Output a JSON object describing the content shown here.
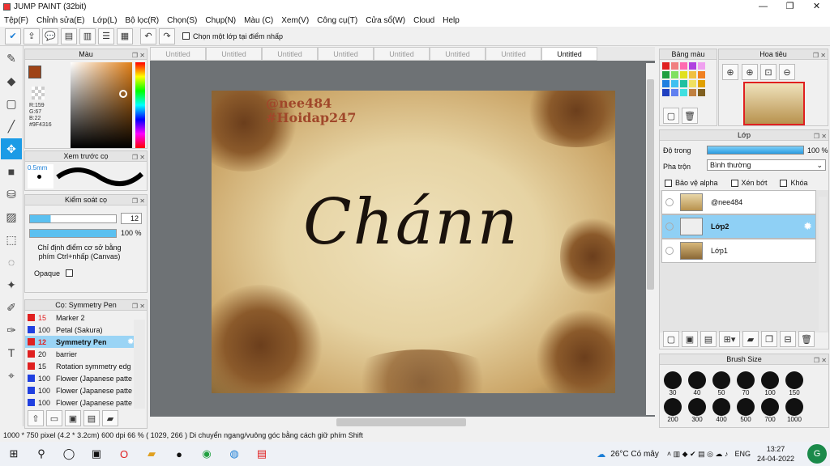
{
  "window": {
    "title": "JUMP PAINT (32bit)",
    "min": "—",
    "max": "❐",
    "close": "✕"
  },
  "menu": [
    "Tệp(F)",
    "Chỉnh sửa(E)",
    "Lớp(L)",
    "Bộ lọc(R)",
    "Chọn(S)",
    "Chụp(N)",
    "Màu (C)",
    "Xem(V)",
    "Công cụ(T)",
    "Cửa sổ(W)",
    "Cloud",
    "Help"
  ],
  "toolbar": {
    "select_layer_label": "Chọn một lớp tại điểm nhấp"
  },
  "color_panel": {
    "title": "Màu",
    "r": "R:159",
    "g": "G:67",
    "b": "B:22",
    "hex": "#9F4316",
    "fg_color": "#9F4316"
  },
  "preview_panel": {
    "title": "Xem trước cọ",
    "size": "0.5mm"
  },
  "brush_control": {
    "title": "Kiểm soát cọ",
    "size_value": "12",
    "opacity_value": "100 %",
    "hint": "Chỉ định điểm cơ sở bằng phím Ctrl+nhấp (Canvas)",
    "opaque_label": "Opaque"
  },
  "brush_list": {
    "title": "Cọ: Symmetry Pen",
    "items": [
      {
        "num": "15",
        "name": "Marker 2",
        "color": "#e02020"
      },
      {
        "num": "100",
        "name": "Petal (Sakura)",
        "color": "#2040e0"
      },
      {
        "num": "12",
        "name": "Symmetry Pen",
        "color": "#e02020"
      },
      {
        "num": "20",
        "name": "barrier",
        "color": "#e02020"
      },
      {
        "num": "15",
        "name": "Rotation symmetry edg",
        "color": "#e02020"
      },
      {
        "num": "100",
        "name": "Flower (Japanese patte",
        "color": "#2040e0"
      },
      {
        "num": "100",
        "name": "Flower (Japanese patte",
        "color": "#2040e0"
      },
      {
        "num": "100",
        "name": "Flower (Japanese patte",
        "color": "#2040e0"
      }
    ]
  },
  "tabs": [
    "Untitled",
    "Untitled",
    "Untitled",
    "Untitled",
    "Untitled",
    "Untitled",
    "Untitled",
    "Untitled"
  ],
  "artwork": {
    "watermark1": "@nee484",
    "watermark2": "#Hoidap247",
    "main_text": "Chánn"
  },
  "palette_panel": {
    "title": "Bảng màu"
  },
  "navigator_panel": {
    "title": "Hoa tiêu"
  },
  "layer_panel": {
    "title": "Lớp",
    "opacity_label": "Độ trong",
    "opacity_value": "100 %",
    "blend_label": "Pha trộn",
    "blend_value": "Bình thường",
    "protect_alpha": "Bảo vệ alpha",
    "clip": "Xén bớt",
    "lock": "Khóa",
    "layers": [
      {
        "name": "@nee484"
      },
      {
        "name": "Lớp2"
      },
      {
        "name": "Lớp1"
      }
    ]
  },
  "brush_size_panel": {
    "title": "Brush Size",
    "sizes": [
      "30",
      "40",
      "50",
      "70",
      "100",
      "150",
      "200",
      "300",
      "400",
      "500",
      "700",
      "1000"
    ]
  },
  "status": {
    "text": "1000 * 750 pixel   (4.2 * 3.2cm)   600 dpi   66 %   ( 1029, 266 )   Di chuyển ngang/vuông góc bằng cách giữ phím Shift"
  },
  "taskbar": {
    "weather": "26°C  Có mây",
    "lang": "ENG",
    "time": "13:27",
    "date": "24-04-2022"
  }
}
